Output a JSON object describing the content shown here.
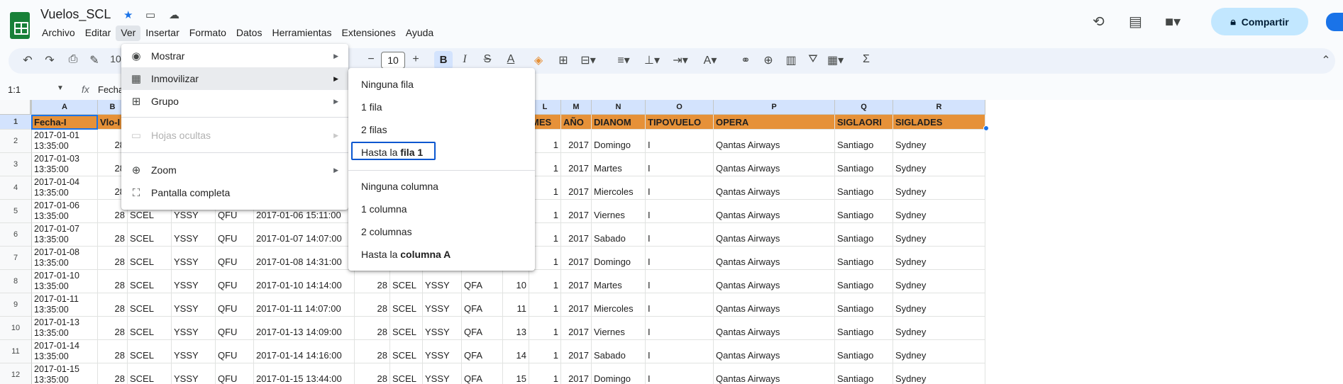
{
  "doc": {
    "title": "Vuelos_SCL"
  },
  "menubar": [
    "Archivo",
    "Editar",
    "Ver",
    "Insertar",
    "Formato",
    "Datos",
    "Herramientas",
    "Extensiones",
    "Ayuda"
  ],
  "header": {
    "share_label": "Compartir"
  },
  "toolbar": {
    "font_size": "10",
    "zoom_partial": "10",
    "bold": "B"
  },
  "formula_bar": {
    "name_box": "1:1",
    "fx": "fx",
    "content": "Fecha"
  },
  "columns": [
    "A",
    "B",
    "",
    "",
    "",
    "",
    "",
    "",
    "",
    "",
    "L",
    "M",
    "N",
    "O",
    "P",
    "Q",
    "R"
  ],
  "header_row": {
    "A": "Fecha-I",
    "B": "Vlo-I",
    "L": "MES",
    "M": "AÑO",
    "N": "DIANOM",
    "O": "TIPOVUELO",
    "P": "OPERA",
    "Q": "SIGLAORI",
    "R": "SIGLADES"
  },
  "rows": [
    {
      "n": "2",
      "a1": "2017-01-01",
      "a2": "13:35:00",
      "b": "28",
      "c": "",
      "d": "",
      "e": "",
      "f": "",
      "g": "",
      "h": "",
      "i": "",
      "j": "",
      "k": "",
      "l": "1",
      "m": "2017",
      "dia": "Domingo",
      "tipo": "I",
      "opera": "Qantas Airways",
      "ori": "Santiago",
      "des": "Sydney"
    },
    {
      "n": "3",
      "a1": "2017-01-03",
      "a2": "13:35:00",
      "b": "28",
      "c": "",
      "d": "",
      "e": "",
      "f": "",
      "g": "",
      "h": "",
      "i": "",
      "j": "",
      "k": "",
      "l": "1",
      "m": "2017",
      "dia": "Martes",
      "tipo": "I",
      "opera": "Qantas Airways",
      "ori": "Santiago",
      "des": "Sydney"
    },
    {
      "n": "4",
      "a1": "2017-01-04",
      "a2": "13:35:00",
      "b": "28",
      "c": "",
      "d": "",
      "e": "",
      "f": "",
      "g": "",
      "h": "",
      "i": "",
      "j": "",
      "k": "",
      "l": "1",
      "m": "2017",
      "dia": "Miercoles",
      "tipo": "I",
      "opera": "Qantas Airways",
      "ori": "Santiago",
      "des": "Sydney"
    },
    {
      "n": "5",
      "a1": "2017-01-06",
      "a2": "13:35:00",
      "b": "28",
      "c": "SCEL",
      "d": "YSSY",
      "e": "QFU",
      "f": "2017-01-06 15:11:00",
      "g": "",
      "h": "",
      "i": "",
      "j": "",
      "k": "",
      "l": "1",
      "m": "2017",
      "dia": "Viernes",
      "tipo": "I",
      "opera": "Qantas Airways",
      "ori": "Santiago",
      "des": "Sydney"
    },
    {
      "n": "6",
      "a1": "2017-01-07",
      "a2": "13:35:00",
      "b": "28",
      "c": "SCEL",
      "d": "YSSY",
      "e": "QFU",
      "f": "2017-01-07 14:07:00",
      "g": "",
      "h": "",
      "i": "",
      "j": "",
      "k": "",
      "l": "1",
      "m": "2017",
      "dia": "Sabado",
      "tipo": "I",
      "opera": "Qantas Airways",
      "ori": "Santiago",
      "des": "Sydney"
    },
    {
      "n": "7",
      "a1": "2017-01-08",
      "a2": "13:35:00",
      "b": "28",
      "c": "SCEL",
      "d": "YSSY",
      "e": "QFU",
      "f": "2017-01-08 14:31:00",
      "g": "",
      "h": "",
      "i": "",
      "j": "",
      "k": "",
      "l": "1",
      "m": "2017",
      "dia": "Domingo",
      "tipo": "I",
      "opera": "Qantas Airways",
      "ori": "Santiago",
      "des": "Sydney"
    },
    {
      "n": "8",
      "a1": "2017-01-10",
      "a2": "13:35:00",
      "b": "28",
      "c": "SCEL",
      "d": "YSSY",
      "e": "QFU",
      "f": "2017-01-10 14:14:00",
      "g": "28",
      "h": "SCEL",
      "i": "YSSY",
      "j": "QFA",
      "k": "10",
      "l": "1",
      "m": "2017",
      "dia": "Martes",
      "tipo": "I",
      "opera": "Qantas Airways",
      "ori": "Santiago",
      "des": "Sydney"
    },
    {
      "n": "9",
      "a1": "2017-01-11",
      "a2": "13:35:00",
      "b": "28",
      "c": "SCEL",
      "d": "YSSY",
      "e": "QFU",
      "f": "2017-01-11 14:07:00",
      "g": "28",
      "h": "SCEL",
      "i": "YSSY",
      "j": "QFA",
      "k": "11",
      "l": "1",
      "m": "2017",
      "dia": "Miercoles",
      "tipo": "I",
      "opera": "Qantas Airways",
      "ori": "Santiago",
      "des": "Sydney"
    },
    {
      "n": "10",
      "a1": "2017-01-13",
      "a2": "13:35:00",
      "b": "28",
      "c": "SCEL",
      "d": "YSSY",
      "e": "QFU",
      "f": "2017-01-13 14:09:00",
      "g": "28",
      "h": "SCEL",
      "i": "YSSY",
      "j": "QFA",
      "k": "13",
      "l": "1",
      "m": "2017",
      "dia": "Viernes",
      "tipo": "I",
      "opera": "Qantas Airways",
      "ori": "Santiago",
      "des": "Sydney"
    },
    {
      "n": "11",
      "a1": "2017-01-14",
      "a2": "13:35:00",
      "b": "28",
      "c": "SCEL",
      "d": "YSSY",
      "e": "QFU",
      "f": "2017-01-14 14:16:00",
      "g": "28",
      "h": "SCEL",
      "i": "YSSY",
      "j": "QFA",
      "k": "14",
      "l": "1",
      "m": "2017",
      "dia": "Sabado",
      "tipo": "I",
      "opera": "Qantas Airways",
      "ori": "Santiago",
      "des": "Sydney"
    },
    {
      "n": "12",
      "a1": "2017-01-15",
      "a2": "13:35:00",
      "b": "28",
      "c": "SCEL",
      "d": "YSSY",
      "e": "QFU",
      "f": "2017-01-15 13:44:00",
      "g": "28",
      "h": "SCEL",
      "i": "YSSY",
      "j": "QFA",
      "k": "15",
      "l": "1",
      "m": "2017",
      "dia": "Domingo",
      "tipo": "I",
      "opera": "Qantas Airways",
      "ori": "Santiago",
      "des": "Sydney"
    }
  ],
  "ver_menu": {
    "items": [
      {
        "label": "Mostrar",
        "icon": "eye-icon",
        "submenu": true,
        "disabled": false
      },
      {
        "label": "Inmovilizar",
        "icon": "freeze-icon",
        "submenu": true,
        "disabled": false
      },
      {
        "label": "Grupo",
        "icon": "group-icon",
        "submenu": true,
        "disabled": false
      },
      {
        "label": "Hojas ocultas",
        "icon": "hidden-sheet-icon",
        "submenu": true,
        "disabled": true
      },
      {
        "label": "Zoom",
        "icon": "zoom-icon",
        "submenu": true,
        "disabled": false
      },
      {
        "label": "Pantalla completa",
        "icon": "fullscreen-icon",
        "submenu": false,
        "disabled": false
      }
    ]
  },
  "freeze_submenu": {
    "rows": [
      {
        "label": "Ninguna fila"
      },
      {
        "label": "1 fila"
      },
      {
        "label": "2 filas"
      },
      {
        "prefix": "Hasta la ",
        "bold": "fila 1"
      }
    ],
    "columns": [
      {
        "label": "Ninguna columna"
      },
      {
        "label": "1 columna"
      },
      {
        "label": "2 columnas"
      },
      {
        "prefix": "Hasta la ",
        "bold": "columna A"
      }
    ]
  },
  "colors": {
    "accent": "#0b57d0",
    "header_fill": "#e69138",
    "share_bg": "#c2e7ff",
    "sheets_green": "#188038"
  }
}
